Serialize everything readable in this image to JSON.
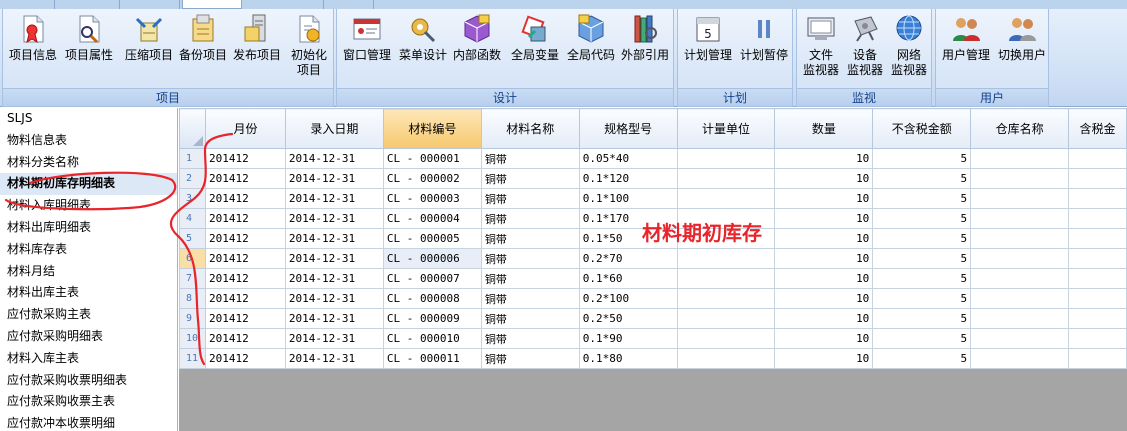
{
  "ribbon": {
    "groups": [
      {
        "title": "项目",
        "buttons": [
          {
            "label": "项目信息",
            "icon": "project-info-icon"
          },
          {
            "label": "项目属性",
            "icon": "project-properties-icon"
          },
          {
            "label": "压缩项目",
            "icon": "compress-project-icon"
          },
          {
            "label": "备份项目",
            "icon": "backup-project-icon"
          },
          {
            "label": "发布项目",
            "icon": "publish-project-icon"
          },
          {
            "label": "初始化\n项目",
            "icon": "init-project-icon"
          }
        ]
      },
      {
        "title": "设计",
        "buttons": [
          {
            "label": "窗口管理",
            "icon": "window-manage-icon"
          },
          {
            "label": "菜单设计",
            "icon": "menu-design-icon"
          },
          {
            "label": "内部函数",
            "icon": "internal-function-icon"
          },
          {
            "label": "全局变量",
            "icon": "global-variable-icon"
          },
          {
            "label": "全局代码",
            "icon": "global-code-icon"
          },
          {
            "label": "外部引用",
            "icon": "external-reference-icon"
          }
        ]
      },
      {
        "title": "计划",
        "buttons": [
          {
            "label": "计划管理",
            "icon": "calendar-icon"
          },
          {
            "label": "计划暂停",
            "icon": "pause-icon"
          }
        ]
      },
      {
        "title": "监视",
        "buttons": [
          {
            "label": "文件\n监视器",
            "icon": "file-monitor-icon"
          },
          {
            "label": "设备\n监视器",
            "icon": "device-monitor-icon"
          },
          {
            "label": "网络\n监视器",
            "icon": "network-monitor-icon"
          }
        ]
      },
      {
        "title": "用户",
        "buttons": [
          {
            "label": "用户管理",
            "icon": "user-manage-icon"
          },
          {
            "label": "切换用户",
            "icon": "switch-user-icon"
          }
        ]
      }
    ]
  },
  "sidebar": {
    "items": [
      "SLJS",
      "物料信息表",
      "材料分类名称",
      "材料期初库存明细表",
      "材料入库明细表",
      "材料出库明细表",
      "材料库存表",
      "材料月结",
      "材料出库主表",
      "应付款采购主表",
      "应付款采购明细表",
      "材料入库主表",
      "应付款采购收票明细表",
      "应付款采购收票主表",
      "应付款冲本收票明细"
    ],
    "active_index": 3
  },
  "grid": {
    "columns": [
      "月份",
      "录入日期",
      "材料编号",
      "材料名称",
      "规格型号",
      "计量单位",
      "数量",
      "不含税金额",
      "仓库名称",
      "含税金"
    ],
    "sorted_column": 2,
    "current_row": 6,
    "highlight_cell": [
      6,
      2
    ],
    "rows": [
      [
        "1",
        "201412",
        "2014-12-31",
        "CL - 000001",
        "铜带",
        "0.05*40",
        "",
        "10",
        "5",
        "",
        ""
      ],
      [
        "2",
        "201412",
        "2014-12-31",
        "CL - 000002",
        "铜带",
        "0.1*120",
        "",
        "10",
        "5",
        "",
        ""
      ],
      [
        "3",
        "201412",
        "2014-12-31",
        "CL - 000003",
        "铜带",
        "0.1*100",
        "",
        "10",
        "5",
        "",
        ""
      ],
      [
        "4",
        "201412",
        "2014-12-31",
        "CL - 000004",
        "铜带",
        "0.1*170",
        "",
        "10",
        "5",
        "",
        ""
      ],
      [
        "5",
        "201412",
        "2014-12-31",
        "CL - 000005",
        "铜带",
        "0.1*50",
        "",
        "10",
        "5",
        "",
        ""
      ],
      [
        "6",
        "201412",
        "2014-12-31",
        "CL - 000006",
        "铜带",
        "0.2*70",
        "",
        "10",
        "5",
        "",
        ""
      ],
      [
        "7",
        "201412",
        "2014-12-31",
        "CL - 000007",
        "铜带",
        "0.1*60",
        "",
        "10",
        "5",
        "",
        ""
      ],
      [
        "8",
        "201412",
        "2014-12-31",
        "CL - 000008",
        "铜带",
        "0.2*100",
        "",
        "10",
        "5",
        "",
        ""
      ],
      [
        "9",
        "201412",
        "2014-12-31",
        "CL - 000009",
        "铜带",
        "0.2*50",
        "",
        "10",
        "5",
        "",
        ""
      ],
      [
        "10",
        "201412",
        "2014-12-31",
        "CL - 000010",
        "铜带",
        "0.1*90",
        "",
        "10",
        "5",
        "",
        ""
      ],
      [
        "11",
        "201412",
        "2014-12-31",
        "CL - 000011",
        "铜带",
        "0.1*80",
        "",
        "10",
        "5",
        "",
        ""
      ]
    ]
  },
  "annotation": {
    "text": "材料期初库存",
    "color": "#e8252a"
  },
  "colors": {
    "accent": "#15428b",
    "annotation": "#e8252a",
    "sorted_header": "#f7c86d"
  }
}
